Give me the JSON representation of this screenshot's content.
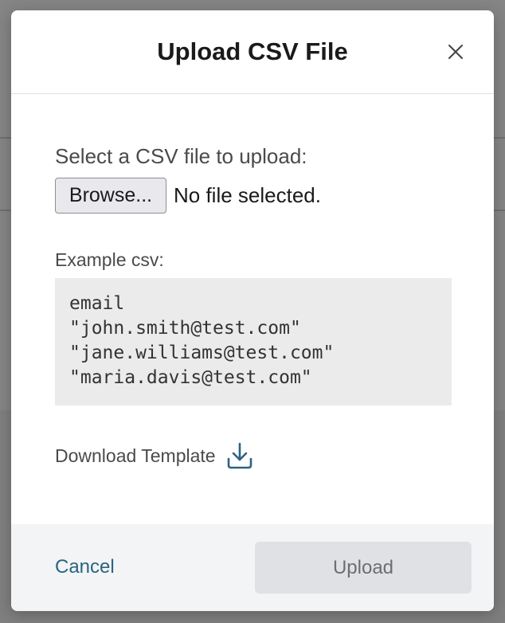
{
  "modal": {
    "title": "Upload CSV File"
  },
  "body": {
    "select_label": "Select a CSV file to upload:",
    "browse_label": "Browse...",
    "file_status": "No file selected.",
    "example_label": "Example csv:",
    "example_lines": [
      "email",
      "\"john.smith@test.com\"",
      "\"jane.williams@test.com\"",
      "\"maria.davis@test.com\""
    ],
    "download_label": "Download Template"
  },
  "footer": {
    "cancel_label": "Cancel",
    "upload_label": "Upload"
  },
  "colors": {
    "accent": "#2a6482",
    "disabled_button_bg": "#dfe1e4",
    "footer_bg": "#f3f4f5"
  },
  "icons": {
    "close": "close-icon",
    "download": "download-icon"
  }
}
